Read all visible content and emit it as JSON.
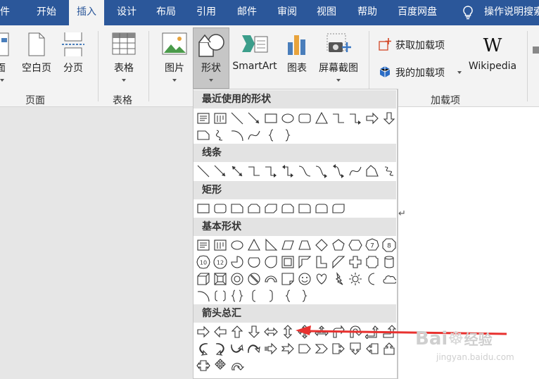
{
  "menu": {
    "tabs": [
      "件",
      "开始",
      "插入",
      "设计",
      "布局",
      "引用",
      "邮件",
      "审阅",
      "视图",
      "帮助",
      "百度网盘",
      "操作说明搜索"
    ],
    "active_index": 2
  },
  "ribbon": {
    "groups": {
      "pages": "页面",
      "tables": "表格",
      "addins": "加载项"
    },
    "buttons": {
      "cover": "面",
      "blank": "空白页",
      "break": "分页",
      "table": "表格",
      "picture": "图片",
      "shapes": "形状",
      "smartart": "SmartArt",
      "chart": "图表",
      "screenshot": "屏幕截图",
      "get_addins": "获取加载项",
      "my_addins": "我的加载项",
      "wikipedia": "Wikipedia",
      "wiki_glyph": "W"
    }
  },
  "shapes_panel": {
    "sections": {
      "recent": "最近使用的形状",
      "lines": "线条",
      "rectangles": "矩形",
      "basic": "基本形状",
      "arrows": "箭头总汇"
    },
    "recent_rows": [
      [
        "text-box-icon",
        "vertical-text-box-icon",
        "line-icon",
        "arrow-line-icon",
        "rectangle-icon",
        "oval-icon",
        "rounded-rectangle-icon",
        "triangle-icon",
        "elbow-connector-icon",
        "elbow-arrow-connector-icon",
        "right-arrow-icon",
        "down-arrow-icon"
      ],
      [
        "snip-rectangle-icon",
        "squiggle-icon",
        "arc-icon",
        "curve-icon",
        "left-brace-icon",
        "right-brace-icon"
      ]
    ],
    "lines_row": [
      "line-icon",
      "arrow-line-icon",
      "double-arrow-line-icon",
      "elbow-connector-icon",
      "elbow-arrow-connector-icon",
      "elbow-double-arrow-icon",
      "curved-connector-icon",
      "curved-arrow-connector-icon",
      "curved-double-arrow-icon",
      "curve-icon",
      "freeform-icon",
      "scribble-icon"
    ],
    "rect_row": [
      "rectangle-icon",
      "rounded-rectangle-icon",
      "snip-single-corner-icon",
      "snip-same-side-icon",
      "snip-diagonal-icon",
      "snip-round-icon",
      "round-single-corner-icon",
      "round-same-side-icon",
      "round-diagonal-icon"
    ],
    "basic_rows": [
      [
        "text-box-icon",
        "vertical-text-box-icon",
        "oval-icon",
        "isosceles-triangle-icon",
        "right-triangle-icon",
        "parallelogram-icon",
        "trapezoid-icon",
        "diamond-icon",
        "pentagon-icon",
        "hexagon-icon",
        "heptagon-icon",
        "octagon-icon"
      ],
      [
        "decagon-icon",
        "dodecagon-icon",
        "pie-icon",
        "chord-icon",
        "teardrop-icon",
        "frame-icon",
        "half-frame-icon",
        "l-shape-icon",
        "diagonal-stripe-icon",
        "cross-icon",
        "plaque-icon",
        "can-icon"
      ],
      [
        "cube-icon",
        "bevel-icon",
        "donut-icon",
        "no-symbol-icon",
        "block-arc-icon",
        "folded-corner-icon",
        "smiley-icon",
        "heart-icon",
        "lightning-icon",
        "sun-icon",
        "moon-icon",
        "cloud-icon"
      ],
      [
        "arc-icon",
        "double-bracket-icon",
        "double-brace-icon",
        "left-bracket-icon",
        "right-bracket-icon",
        "left-brace-icon",
        "right-brace-icon"
      ]
    ],
    "arrow_rows": [
      [
        "right-arrow-icon",
        "left-arrow-icon",
        "up-arrow-icon",
        "down-arrow-icon",
        "left-right-arrow-icon",
        "up-down-arrow-icon",
        "quad-arrow-icon",
        "left-right-up-arrow-icon",
        "bent-arrow-icon",
        "u-turn-arrow-icon",
        "left-up-arrow-icon",
        "bent-up-arrow-icon"
      ],
      [
        "curved-right-arrow-icon",
        "curved-left-arrow-icon",
        "curved-up-arrow-icon",
        "curved-down-arrow-icon",
        "striped-right-arrow-icon",
        "notched-right-arrow-icon",
        "pentagon-arrow-icon",
        "chevron-arrow-icon",
        "right-arrow-callout-icon",
        "down-arrow-callout-icon",
        "left-arrow-callout-icon",
        "up-arrow-callout-icon"
      ],
      [
        "left-right-arrow-callout-icon",
        "quad-arrow-callout-icon",
        "circular-arrow-icon"
      ]
    ],
    "heptagon_label": "7",
    "octagon_label": "8",
    "decagon_label": "10",
    "dodecagon_label": "12"
  },
  "annotation": {
    "color": "#e8312f"
  },
  "watermark": {
    "logo": "Bai",
    "logo_tail": "经验",
    "url": "jingyan.baidu.com"
  }
}
